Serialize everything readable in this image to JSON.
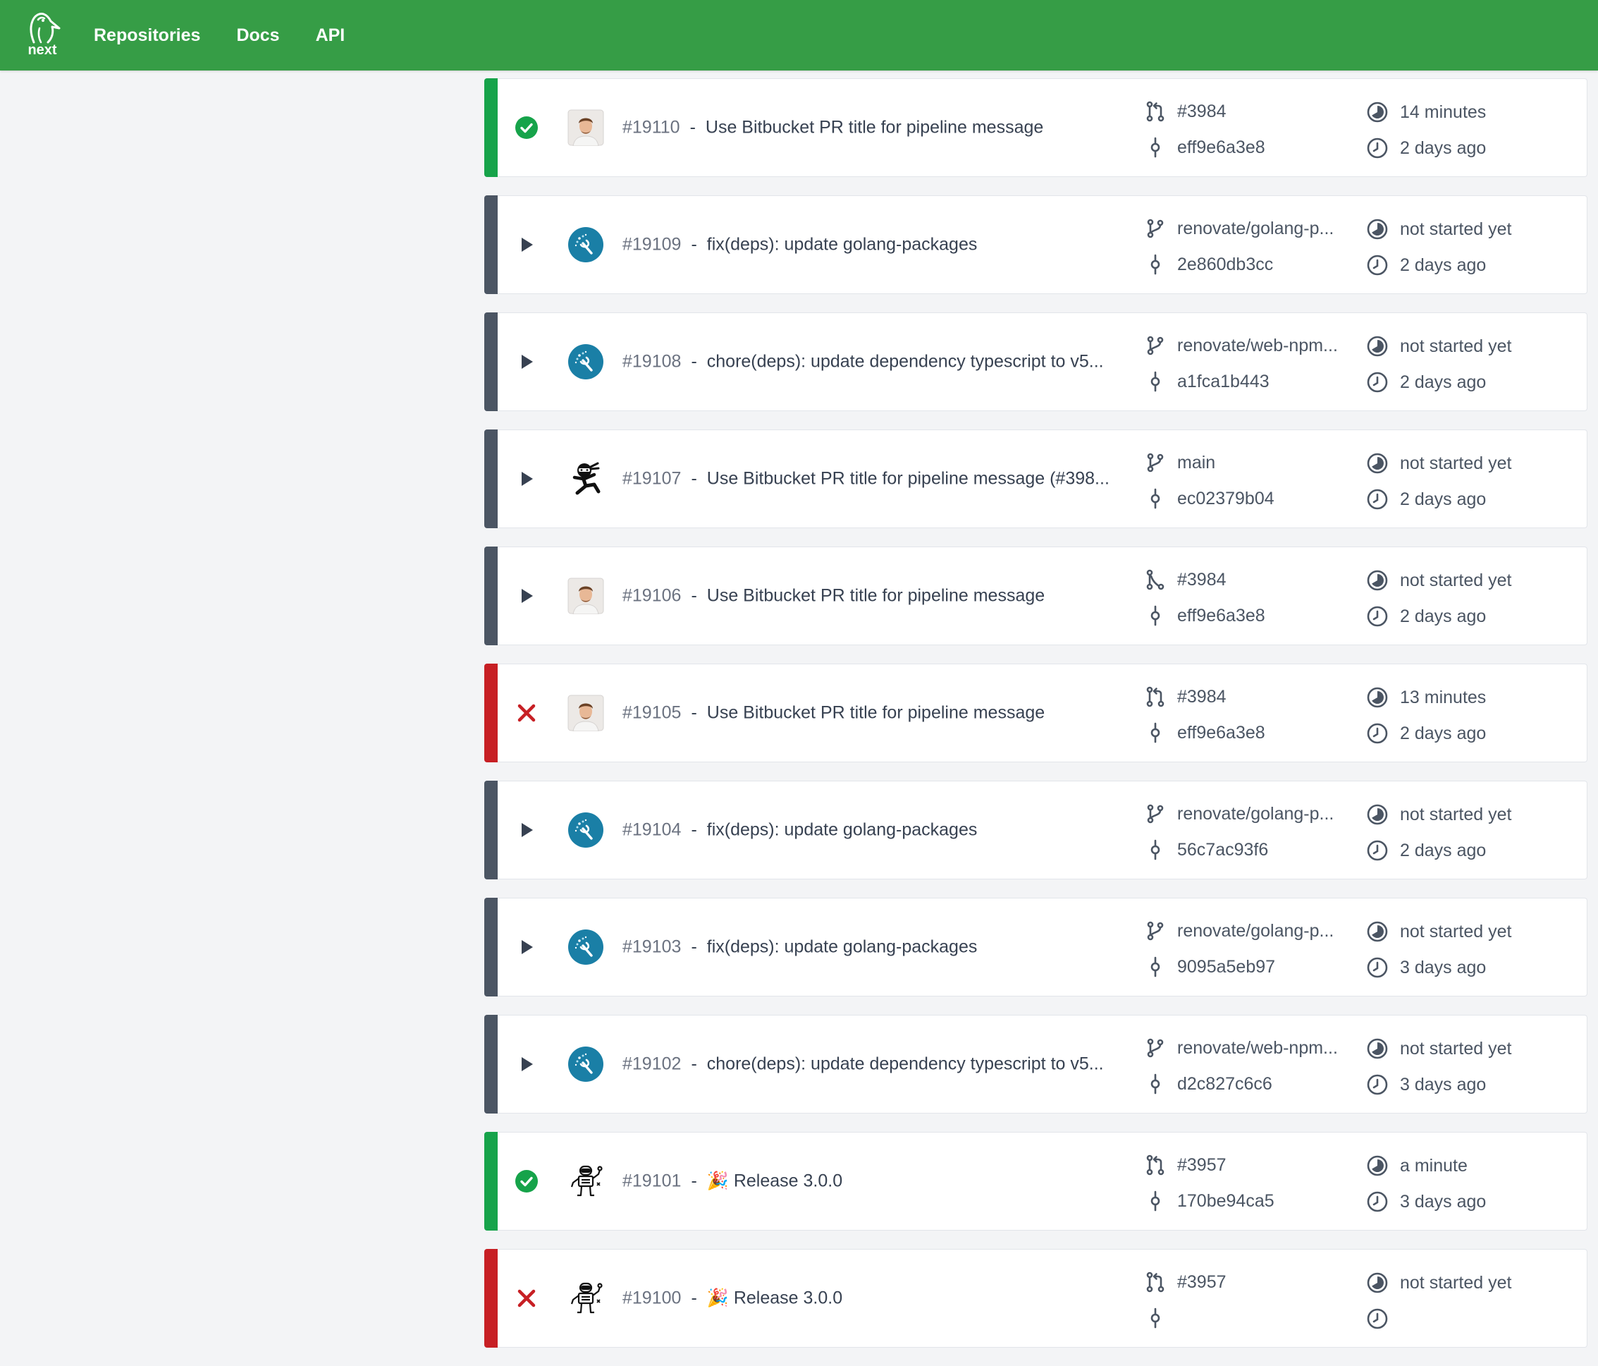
{
  "header": {
    "logo_text": "next",
    "nav": [
      "Repositories",
      "Docs",
      "API"
    ]
  },
  "colors": {
    "header": "#369d46",
    "success": "#16a34a",
    "failure": "#c71f24",
    "pending": "#4b5563"
  },
  "pipelines": [
    {
      "status": "success",
      "avatar": "person-avatar",
      "number": "#19110",
      "message": "Use Bitbucket PR title for pipeline message",
      "ref_icon": "pull-request-icon",
      "ref": "#3984",
      "commit": "eff9e6a3e8",
      "duration": "14 minutes",
      "since": "2 days ago"
    },
    {
      "status": "pending",
      "avatar": "renovate-avatar",
      "number": "#19109",
      "message": "fix(deps): update golang-packages",
      "ref_icon": "branch-icon",
      "ref": "renovate/golang-p...",
      "commit": "2e860db3cc",
      "duration": "not started yet",
      "since": "2 days ago"
    },
    {
      "status": "pending",
      "avatar": "renovate-avatar",
      "number": "#19108",
      "message": "chore(deps): update dependency typescript to v5...",
      "ref_icon": "branch-icon",
      "ref": "renovate/web-npm...",
      "commit": "a1fca1b443",
      "duration": "not started yet",
      "since": "2 days ago"
    },
    {
      "status": "pending",
      "avatar": "ninja-avatar",
      "number": "#19107",
      "message": "Use Bitbucket PR title for pipeline message (#398...",
      "ref_icon": "branch-icon",
      "ref": "main",
      "commit": "ec02379b04",
      "duration": "not started yet",
      "since": "2 days ago"
    },
    {
      "status": "pending",
      "avatar": "person-avatar",
      "number": "#19106",
      "message": "Use Bitbucket PR title for pipeline message",
      "ref_icon": "pr-closed-icon",
      "ref": "#3984",
      "commit": "eff9e6a3e8",
      "duration": "not started yet",
      "since": "2 days ago"
    },
    {
      "status": "failure",
      "avatar": "person-avatar",
      "number": "#19105",
      "message": "Use Bitbucket PR title for pipeline message",
      "ref_icon": "pull-request-icon",
      "ref": "#3984",
      "commit": "eff9e6a3e8",
      "duration": "13 minutes",
      "since": "2 days ago"
    },
    {
      "status": "pending",
      "avatar": "renovate-avatar",
      "number": "#19104",
      "message": "fix(deps): update golang-packages",
      "ref_icon": "branch-icon",
      "ref": "renovate/golang-p...",
      "commit": "56c7ac93f6",
      "duration": "not started yet",
      "since": "2 days ago"
    },
    {
      "status": "pending",
      "avatar": "renovate-avatar",
      "number": "#19103",
      "message": "fix(deps): update golang-packages",
      "ref_icon": "branch-icon",
      "ref": "renovate/golang-p...",
      "commit": "9095a5eb97",
      "duration": "not started yet",
      "since": "3 days ago"
    },
    {
      "status": "pending",
      "avatar": "renovate-avatar",
      "number": "#19102",
      "message": "chore(deps): update dependency typescript to v5...",
      "ref_icon": "branch-icon",
      "ref": "renovate/web-npm...",
      "commit": "d2c827c6c6",
      "duration": "not started yet",
      "since": "3 days ago"
    },
    {
      "status": "success",
      "avatar": "robot-avatar",
      "number": "#19101",
      "message": "🎉 Release 3.0.0",
      "ref_icon": "pull-request-icon",
      "ref": "#3957",
      "commit": "170be94ca5",
      "duration": "a minute",
      "since": "3 days ago"
    },
    {
      "status": "failure",
      "avatar": "robot-avatar",
      "number": "#19100",
      "message": "🎉 Release 3.0.0",
      "ref_icon": "pull-request-icon",
      "ref": "#3957",
      "commit": "",
      "duration": "not started yet",
      "since": ""
    }
  ]
}
